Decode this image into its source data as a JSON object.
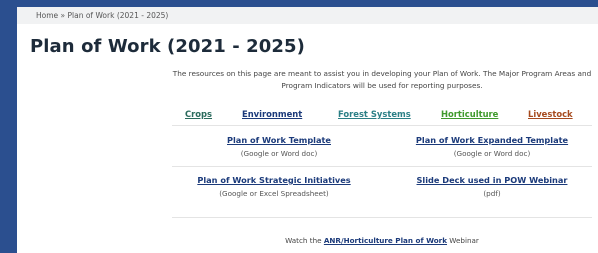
{
  "breadcrumb": "Home » Plan of Work (2021 - 2025)",
  "page_title": "Plan of Work (2021 - 2025)",
  "intro": "The resources on this page are meant to assist you in developing your Plan of Work. The Major Program Areas and Program Indicators will be used for reporting purposes.",
  "categories": [
    {
      "label": "Crops",
      "color": "#2a6a5c"
    },
    {
      "label": "Environment",
      "color": "#1b3a7a"
    },
    {
      "label": "Forest Systems",
      "color": "#2b7f86"
    },
    {
      "label": "Horticulture",
      "color": "#3f9a2c"
    },
    {
      "label": "Livestock",
      "color": "#a64a1e"
    }
  ],
  "resources": [
    {
      "title": "Plan of Work Template",
      "note": "(Google or Word doc)"
    },
    {
      "title": "Plan of Work Expanded Template",
      "note": "(Google or Word doc)"
    },
    {
      "title": "Plan of Work Strategic Initiatives",
      "note": "(Google or Excel Spreadsheet)"
    },
    {
      "title": "Slide Deck used in POW Webinar",
      "note": "(pdf)"
    }
  ],
  "webinar": {
    "prefix": "Watch the ",
    "link": "ANR/Horticulture Plan of Work",
    "suffix": " Webinar"
  },
  "colors": {
    "frame": "#2b4f8f",
    "link": "#1b3a7a"
  }
}
